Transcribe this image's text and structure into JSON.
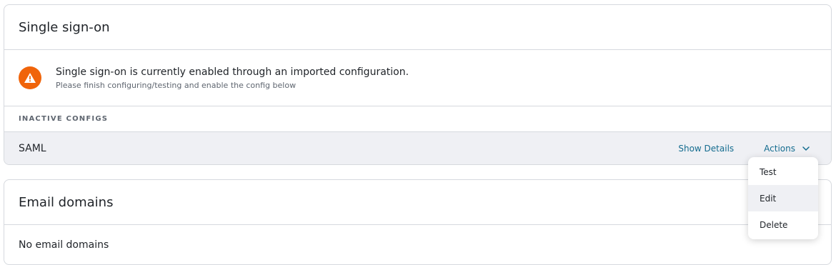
{
  "sso": {
    "title": "Single sign-on",
    "alert": {
      "icon": "warning-icon",
      "title": "Single sign-on is currently enabled through an imported configuration.",
      "subtitle": "Please finish configuring/testing and enable the config below"
    },
    "inactive_label": "INACTIVE CONFIGS",
    "config": {
      "name": "SAML",
      "show_details": "Show Details",
      "actions": "Actions"
    },
    "actions_menu": [
      "Test",
      "Edit",
      "Delete"
    ],
    "highlighted_menu_item": "Edit"
  },
  "email": {
    "title": "Email domains",
    "empty_text": "No email domains"
  },
  "colors": {
    "accent_link": "#146c8f",
    "warning": "#f0640a",
    "row_bg": "#eff0f4",
    "border": "#d6d9de"
  }
}
